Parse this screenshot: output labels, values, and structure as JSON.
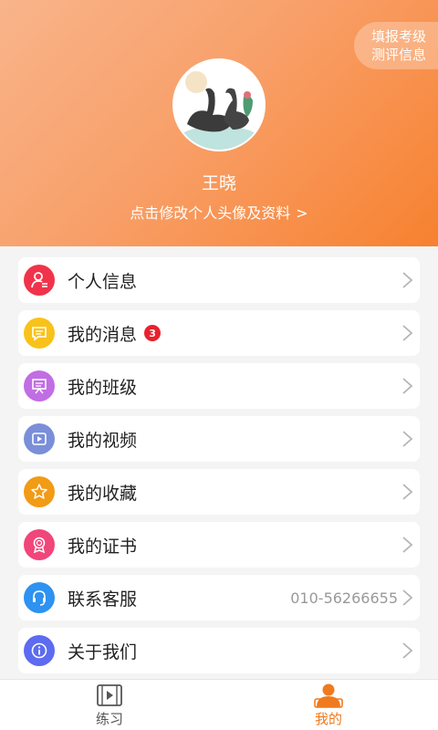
{
  "header": {
    "pill_line1": "填报考级",
    "pill_line2": "测评信息",
    "username": "王晓",
    "edit_link": "点击修改个人头像及资料"
  },
  "menu": [
    {
      "label": "个人信息",
      "icon": "person-icon",
      "color": "#f0334a"
    },
    {
      "label": "我的消息",
      "icon": "message-icon",
      "color": "#f9c21b",
      "badge": "3"
    },
    {
      "label": "我的班级",
      "icon": "class-board-icon",
      "color": "#c16de4"
    },
    {
      "label": "我的视频",
      "icon": "video-icon",
      "color": "#7a8fd8"
    },
    {
      "label": "我的收藏",
      "icon": "star-icon",
      "color": "#f19b16"
    },
    {
      "label": "我的证书",
      "icon": "certificate-icon",
      "color": "#f0467a"
    },
    {
      "label": "联系客服",
      "icon": "headset-icon",
      "color": "#2d92f0",
      "extra": "010-56266655"
    },
    {
      "label": "关于我们",
      "icon": "info-icon",
      "color": "#5c6bf0"
    }
  ],
  "tabbar": {
    "tabs": [
      {
        "label": "练习",
        "icon": "practice-video-icon",
        "active": false
      },
      {
        "label": "我的",
        "icon": "profile-icon",
        "active": true
      }
    ],
    "active_color": "#f07a1f"
  }
}
